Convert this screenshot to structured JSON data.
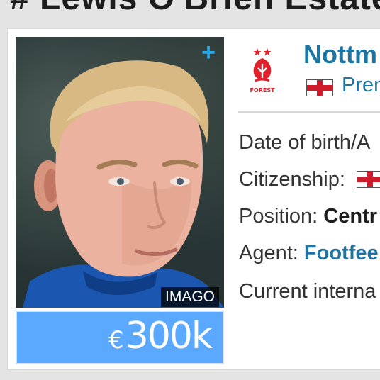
{
  "header": {
    "partial_title": "#  Lewis O'Brien Estates"
  },
  "player": {
    "photo_credit": "IMAGO",
    "market_value_currency": "€",
    "market_value_amount": "300k"
  },
  "club": {
    "name": "Nottm",
    "league": "Prem",
    "crest_text": "FOREST"
  },
  "info": {
    "dob_label": "Date of birth/A",
    "citizenship_label": "Citizenship:",
    "position_label": "Position:",
    "position_value": "Centr",
    "agent_label": "Agent:",
    "agent_value": "Footfee",
    "international_label": "Current interna"
  },
  "icons": {
    "plus": "plus-icon",
    "crest": "club-crest-icon",
    "flag": "england-flag-icon"
  },
  "colors": {
    "link": "#1d75a3",
    "value_box": "#5aa9ff",
    "plus": "#2aa9e6",
    "crest": "#e0202a"
  }
}
